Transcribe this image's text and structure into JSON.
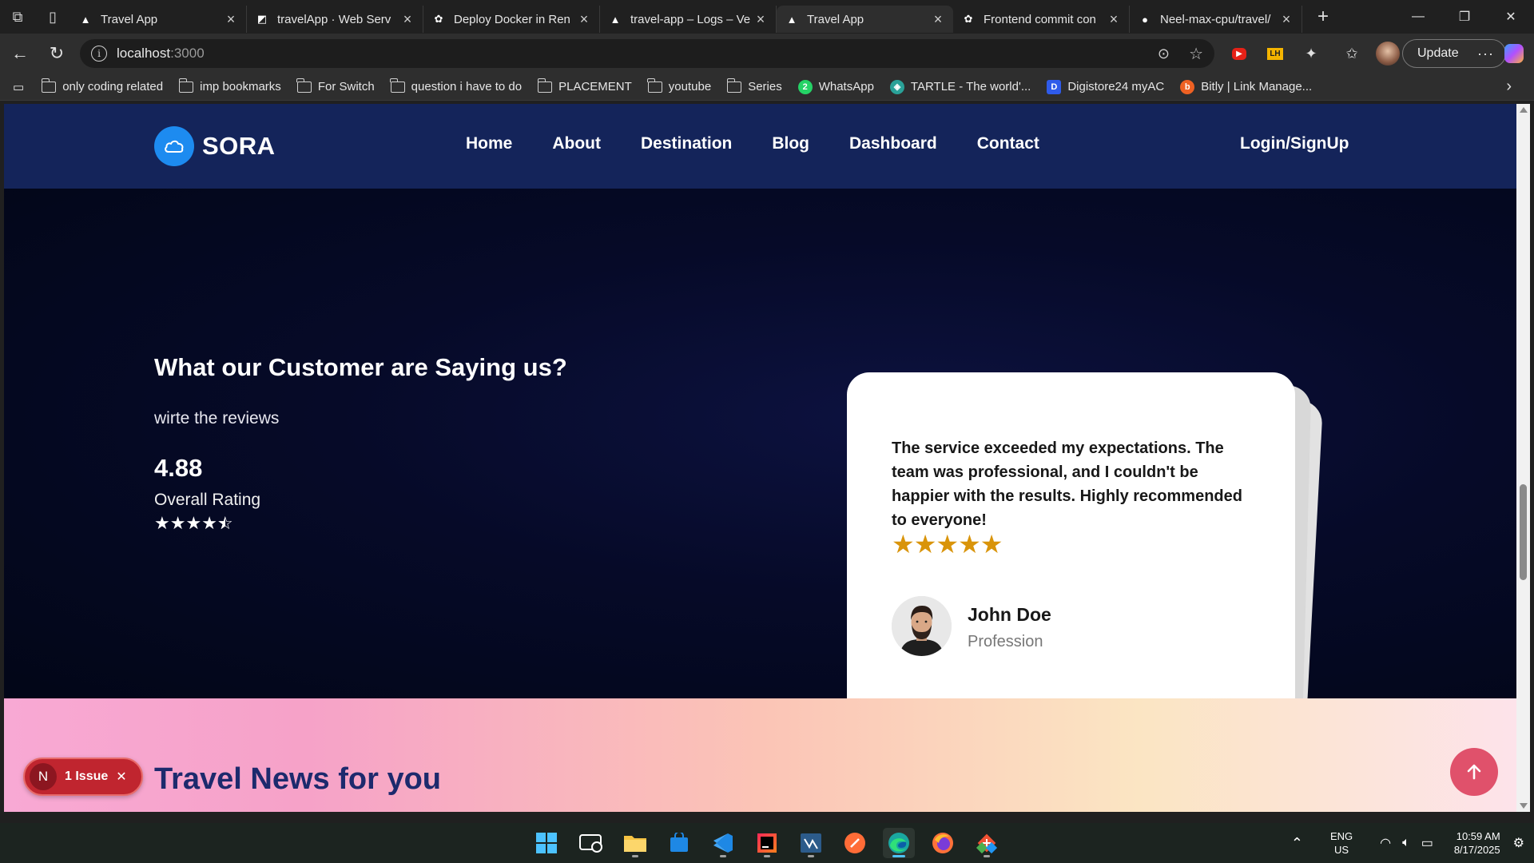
{
  "browser": {
    "tabs": [
      {
        "title": "Travel App",
        "icon": "vercel-triangle-icon",
        "active": false
      },
      {
        "title": "travelApp · Web Serv",
        "icon": "render-icon",
        "active": false
      },
      {
        "title": "Deploy Docker in Ren",
        "icon": "chatgpt-icon",
        "active": false
      },
      {
        "title": "travel-app – Logs – Ve",
        "icon": "vercel-triangle-icon",
        "active": false
      },
      {
        "title": "Travel App",
        "icon": "vercel-triangle-icon",
        "active": true
      },
      {
        "title": "Frontend commit con",
        "icon": "chatgpt-icon",
        "active": false
      },
      {
        "title": "Neel-max-cpu/travel/",
        "icon": "github-icon",
        "active": false
      }
    ],
    "address": {
      "host": "localhost",
      "port": ":3000"
    },
    "update_label": "Update",
    "bookmarks": [
      {
        "label": "only coding  related",
        "type": "folder"
      },
      {
        "label": "imp bookmarks",
        "type": "folder"
      },
      {
        "label": "For Switch",
        "type": "folder"
      },
      {
        "label": "question i have to do",
        "type": "folder"
      },
      {
        "label": "PLACEMENT",
        "type": "folder"
      },
      {
        "label": "youtube",
        "type": "folder"
      },
      {
        "label": "Series",
        "type": "folder"
      },
      {
        "label": "WhatsApp",
        "type": "site",
        "icon": "whatsapp-icon",
        "color": "#25d366",
        "glyph": "2"
      },
      {
        "label": "TARTLE - The world'...",
        "type": "site",
        "icon": "tartle-icon",
        "color": "#2aa198",
        "glyph": "◈"
      },
      {
        "label": "Digistore24 myAC",
        "type": "site",
        "icon": "digistore-icon",
        "color": "#2f5bea",
        "glyph": "D"
      },
      {
        "label": "Bitly | Link Manage...",
        "type": "site",
        "icon": "bitly-icon",
        "color": "#ee6123",
        "glyph": "b"
      }
    ]
  },
  "site": {
    "brand": "SORA",
    "nav": [
      "Home",
      "About",
      "Destination",
      "Blog",
      "Dashboard",
      "Contact"
    ],
    "login": "Login/SignUp",
    "testimonials": {
      "heading": "What our Customer are Saying us?",
      "subheading": "wirte the reviews",
      "overall_score": "4.88",
      "overall_label": "Overall Rating",
      "overall_stars": 4.5,
      "review": {
        "text": "The service exceeded my expectations. The team was professional, and I couldn't be happier with the results. Highly recommended to everyone!",
        "stars": 5,
        "name": "John Doe",
        "profession": "Profession"
      }
    },
    "news": {
      "title": "Travel News for you"
    },
    "issue_badge": {
      "letter": "N",
      "label": "1 Issue"
    }
  },
  "taskbar": {
    "apps": [
      "windows-start-icon",
      "devhome-icon",
      "file-explorer-icon",
      "microsoft-store-icon",
      "vscode-icon",
      "intellij-icon",
      "mysql-workbench-icon",
      "postman-icon",
      "edge-browser-icon",
      "firefox-icon",
      "git-icon"
    ],
    "language": "ENG",
    "region": "US",
    "time": "10:59 AM",
    "date": "8/17/2025"
  },
  "colors": {
    "nav_bg": "#14245a",
    "brand_blue": "#1d8bf0",
    "star_gold": "#d9940a",
    "news_title": "#1d2a6d",
    "scroll_top_button": "#e0516b",
    "issue_badge": "#c0252f"
  }
}
